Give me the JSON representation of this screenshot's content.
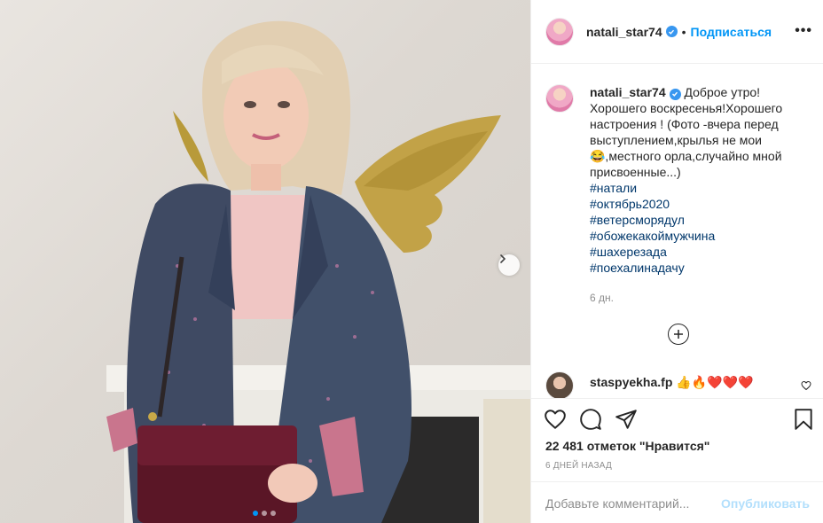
{
  "post": {
    "username": "natali_star74",
    "follow_label": "Подписаться",
    "bullet": "•",
    "more_label": "•••",
    "caption_text": "Доброе утро! Хорошего воскресенья!Хорошего настроения ! (Фото -вчера перед выступлением,крылья не мои 😂,местного орла,случайно мной присвоенные...)",
    "hashtags": [
      "#натали",
      "#октябрь2020",
      "#ветерсморядул",
      "#обожекакоймужчина",
      "#шахерезада",
      "#поехалинадачу"
    ],
    "caption_time": "6 дн.",
    "comment": {
      "username": "staspyekha.fp",
      "text": "👍🔥❤️❤️❤️"
    },
    "likes": "22 481 отметок \"Нравится\"",
    "date": "6 ДНЕЙ НАЗАД",
    "add_comment_placeholder": "Добавьте комментарий...",
    "publish_label": "Опубликовать"
  },
  "carousel": {
    "count": 3,
    "active": 0
  },
  "colors": {
    "accent": "#0095f6",
    "verified": "#3897f0",
    "text": "#262626",
    "muted": "#8e8e8e",
    "hashtag": "#00376b"
  },
  "icons": [
    "verified-badge-icon",
    "more-options-icon",
    "next-arrow-icon",
    "load-more-plus-icon",
    "heart-icon",
    "comment-icon",
    "share-icon",
    "bookmark-icon"
  ]
}
